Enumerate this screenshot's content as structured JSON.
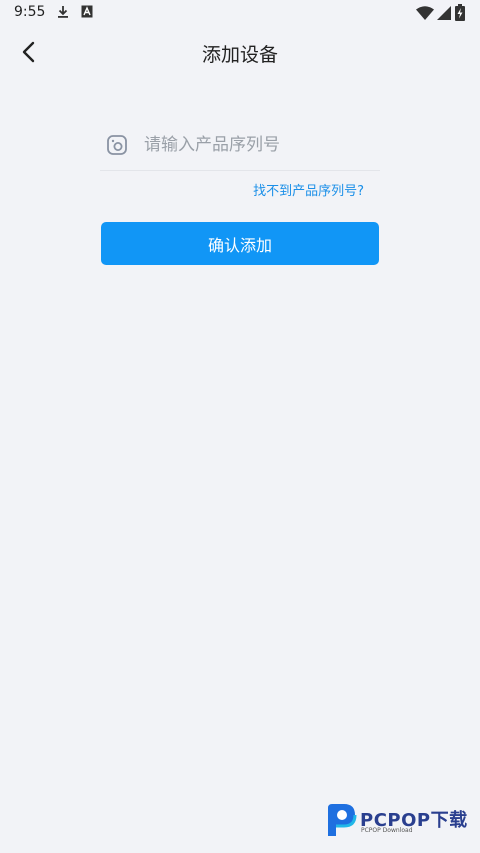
{
  "status_bar": {
    "time": "9:55"
  },
  "nav": {
    "title": "添加设备"
  },
  "serial": {
    "placeholder": "请输入产品序列号",
    "value": ""
  },
  "help_link": "找不到产品序列号?",
  "confirm_label": "确认添加",
  "watermark": {
    "brand": "PCPOP下载",
    "sub": "PCPOP Download"
  },
  "colors": {
    "background": "#f2f3f7",
    "accent": "#1196f6",
    "link": "#1a8fe8"
  }
}
